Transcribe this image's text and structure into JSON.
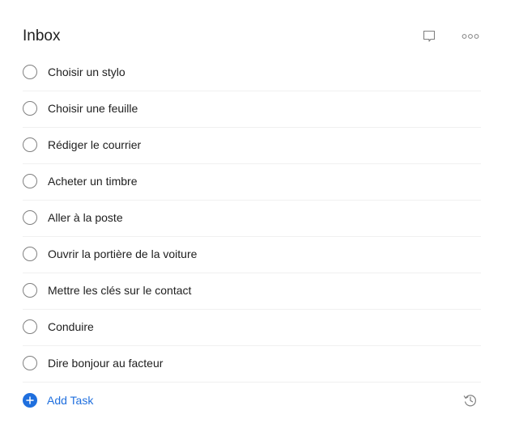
{
  "project": {
    "title": "Inbox"
  },
  "header_icons": {
    "comment": "comment-icon",
    "more": "more-options-icon"
  },
  "tasks": [
    {
      "label": "Choisir un stylo",
      "completed": false
    },
    {
      "label": "Choisir une feuille",
      "completed": false
    },
    {
      "label": "Rédiger le courrier",
      "completed": false
    },
    {
      "label": "Acheter un timbre",
      "completed": false
    },
    {
      "label": "Aller à la poste",
      "completed": false
    },
    {
      "label": "Ouvrir la portière de la voiture",
      "completed": false
    },
    {
      "label": "Mettre les clés sur le contact",
      "completed": false
    },
    {
      "label": "Conduire",
      "completed": false
    },
    {
      "label": "Dire bonjour au facteur",
      "completed": false
    }
  ],
  "add_task": {
    "label": "Add Task",
    "icon": "plus-circle-icon"
  },
  "history_icon": "history-icon",
  "colors": {
    "accent": "#1f6fde",
    "text": "#202020",
    "checkbox_border": "#808080",
    "divider": "#f0f0f0"
  }
}
